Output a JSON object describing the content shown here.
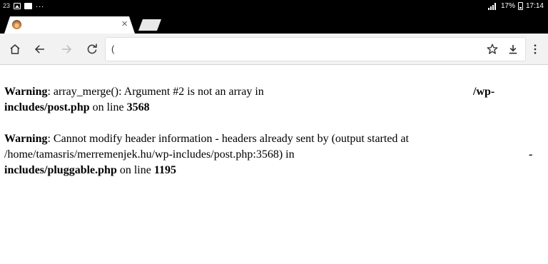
{
  "status_bar": {
    "notification_count": "23",
    "more": "...",
    "battery": "17%",
    "time": "17:14",
    "icons": [
      "image-icon",
      "app-notification-icon",
      "signal-icon",
      "battery-icon"
    ]
  },
  "tabs": [
    {
      "title": "",
      "close": "×"
    }
  ],
  "toolbar": {
    "address_value": "(",
    "icons": [
      "home-icon",
      "back-icon",
      "forward-icon",
      "reload-icon",
      "star-icon",
      "download-icon",
      "menu-icon"
    ]
  },
  "warnings": [
    {
      "label": "Warning",
      "message_line1": ": array_merge(): Argument #2 is not an array in",
      "fragment_right": "/wp-",
      "file": "includes/post.php",
      "on_line": " on line ",
      "line_no": "3568"
    },
    {
      "label": "Warning",
      "message_line1": ": Cannot modify header information - headers already sent by (output started at",
      "message_line2": "/home/tamasris/merremenjek.hu/wp-includes/post.php:3568) in",
      "fragment_right": "-",
      "file": "includes/pluggable.php",
      "on_line": " on line ",
      "line_no": "1195"
    }
  ],
  "colors": {
    "status_bar": "#000000",
    "toolbar": "#f2f2f2",
    "page": "#ffffff"
  }
}
